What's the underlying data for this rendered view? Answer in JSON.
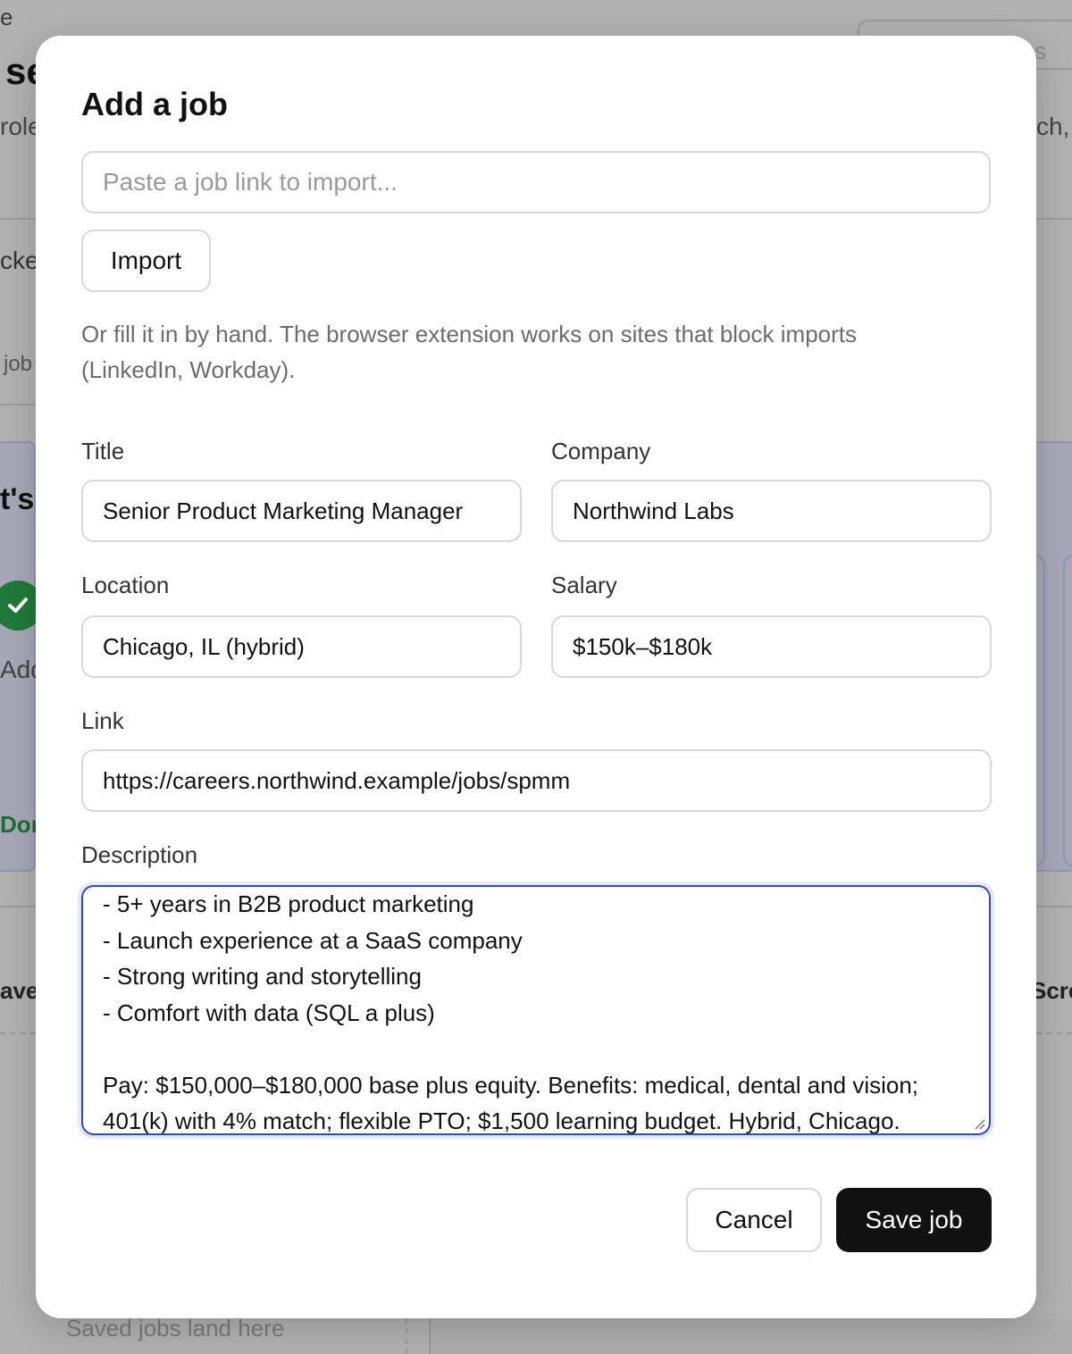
{
  "background": {
    "top_fragment": "e",
    "heading_fragment": "se",
    "role_fragment": "role",
    "tracked_fragment": "cke",
    "job_fragment": "job",
    "lets_fragment": "t's",
    "add_fragment": "Add",
    "done_fragment": "Don",
    "save_fragment": "ave",
    "right_search_fragment": "s",
    "right_text_fragment": "ch,",
    "screen_fragment": "Scre",
    "saved_placeholder": "Saved jobs land here"
  },
  "modal": {
    "title": "Add a job",
    "import": {
      "placeholder": "Paste a job link to import...",
      "button_label": "Import"
    },
    "hint": "Or fill it in by hand. The browser extension works on sites that block imports (LinkedIn, Workday).",
    "fields": {
      "title": {
        "label": "Title",
        "value": "Senior Product Marketing Manager"
      },
      "company": {
        "label": "Company",
        "value": "Northwind Labs"
      },
      "location": {
        "label": "Location",
        "value": "Chicago, IL (hybrid)"
      },
      "salary": {
        "label": "Salary",
        "value": "$150k–$180k"
      },
      "link": {
        "label": "Link",
        "value": "https://careers.northwind.example/jobs/spmm"
      },
      "description": {
        "label": "Description",
        "lines": [
          "- 5+ years in B2B product marketing",
          "- Launch experience at a SaaS company",
          "- Strong writing and storytelling",
          "- Comfort with data (SQL a plus)",
          "",
          "Pay: $150,000–$180,000 base plus equity. Benefits: medical, dental and vision;",
          "401(k) with 4% match; flexible PTO; $1,500 learning budget. Hybrid, Chicago."
        ]
      }
    },
    "actions": {
      "cancel_label": "Cancel",
      "save_label": "Save job"
    }
  },
  "colors": {
    "overlay": "#b1b1b1",
    "focus_border": "#2f49c9",
    "primary_button": "#111111",
    "success_check": "#1f7a39"
  }
}
